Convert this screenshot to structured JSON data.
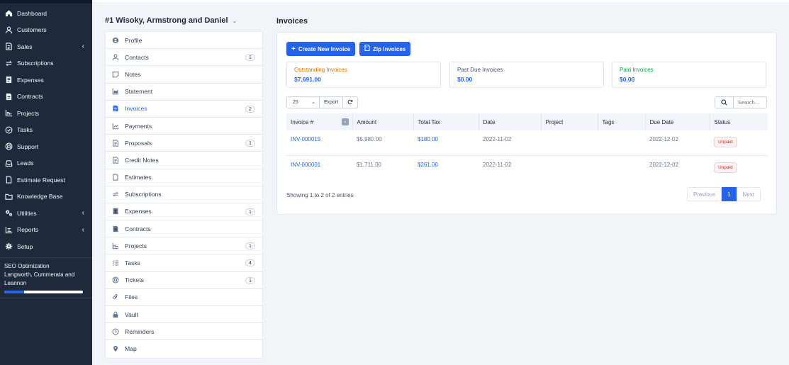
{
  "sidebar": {
    "items": [
      {
        "label": "Dashboard",
        "icon": "home-icon",
        "submenu": false
      },
      {
        "label": "Customers",
        "icon": "user-icon",
        "submenu": false
      },
      {
        "label": "Sales",
        "icon": "document-icon",
        "submenu": true
      },
      {
        "label": "Subscriptions",
        "icon": "refresh-icon",
        "submenu": false
      },
      {
        "label": "Expenses",
        "icon": "receipt-icon",
        "submenu": false
      },
      {
        "label": "Contracts",
        "icon": "contract-icon",
        "submenu": false
      },
      {
        "label": "Projects",
        "icon": "chart-icon",
        "submenu": false
      },
      {
        "label": "Tasks",
        "icon": "check-circle-icon",
        "submenu": false
      },
      {
        "label": "Support",
        "icon": "lifebuoy-icon",
        "submenu": false
      },
      {
        "label": "Leads",
        "icon": "inbox-icon",
        "submenu": false
      },
      {
        "label": "Estimate Request",
        "icon": "file-icon",
        "submenu": false
      },
      {
        "label": "Knowledge Base",
        "icon": "folder-icon",
        "submenu": false
      },
      {
        "label": "Utilities",
        "icon": "cogs-icon",
        "submenu": true
      },
      {
        "label": "Reports",
        "icon": "bar-chart-icon",
        "submenu": true
      },
      {
        "label": "Setup",
        "icon": "gear-icon",
        "submenu": false
      }
    ],
    "project": {
      "name": "SEO Optimization",
      "client": "Langworth, Cummerata and Leannon",
      "progress": 0.25
    }
  },
  "customer": {
    "title": "#1 Wisoky, Armstrong and Daniel",
    "menu": [
      {
        "label": "Profile",
        "icon": "user-circle-icon",
        "badge": ""
      },
      {
        "label": "Contacts",
        "icon": "user-icon",
        "badge": "1"
      },
      {
        "label": "Notes",
        "icon": "note-icon",
        "badge": ""
      },
      {
        "label": "Statement",
        "icon": "chart-area-icon",
        "badge": ""
      },
      {
        "label": "Invoices",
        "icon": "invoice-icon",
        "badge": "2",
        "active": true
      },
      {
        "label": "Payments",
        "icon": "line-chart-icon",
        "badge": ""
      },
      {
        "label": "Proposals",
        "icon": "document-icon",
        "badge": "1"
      },
      {
        "label": "Credit Notes",
        "icon": "document-icon",
        "badge": ""
      },
      {
        "label": "Estimates",
        "icon": "file-icon",
        "badge": ""
      },
      {
        "label": "Subscriptions",
        "icon": "refresh-icon",
        "badge": ""
      },
      {
        "label": "Expenses",
        "icon": "receipt-icon",
        "badge": "1"
      },
      {
        "label": "Contracts",
        "icon": "contract-icon",
        "badge": ""
      },
      {
        "label": "Projects",
        "icon": "chart-icon",
        "badge": "1"
      },
      {
        "label": "Tasks",
        "icon": "list-icon",
        "badge": "4"
      },
      {
        "label": "Tickets",
        "icon": "lifebuoy-icon",
        "badge": "1"
      },
      {
        "label": "Files",
        "icon": "paperclip-icon",
        "badge": ""
      },
      {
        "label": "Vault",
        "icon": "lock-icon",
        "badge": ""
      },
      {
        "label": "Reminders",
        "icon": "clock-icon",
        "badge": ""
      },
      {
        "label": "Map",
        "icon": "map-pin-icon",
        "badge": ""
      }
    ]
  },
  "main": {
    "title": "Invoices",
    "create_button": "Create New Invoice",
    "zip_button": "Zip Invoices",
    "stats": [
      {
        "label": "Outstanding Invoices",
        "value": "$7,691.00",
        "color": "#d97706"
      },
      {
        "label": "Past Due Invoices",
        "value": "$0.00",
        "color": "#475569"
      },
      {
        "label": "Paid Invoices",
        "value": "$0.00",
        "color": "#16a34a"
      }
    ],
    "page_length": "25",
    "export_label": "Export",
    "search_placeholder": "Search...",
    "columns": [
      "Invoice #",
      "Amount",
      "Total Tax",
      "Date",
      "Project",
      "Tags",
      "Due Date",
      "Status"
    ],
    "rows": [
      {
        "invoice": "INV-000015",
        "amount": "$5,980.00",
        "tax": "$180.00",
        "date": "2022-11-02",
        "project": "",
        "tags": "",
        "due": "2022-12-02",
        "status": "Unpaid"
      },
      {
        "invoice": "INV-000001",
        "amount": "$1,711.00",
        "tax": "$261.00",
        "date": "2022-11-02",
        "project": "",
        "tags": "",
        "due": "2022-12-02",
        "status": "Unpaid"
      }
    ],
    "showing": "Showing 1 to 2 of 2 entries",
    "pager": {
      "previous": "Previous",
      "current": "1",
      "next": "Next"
    }
  },
  "colors": {
    "accent": "#2563eb",
    "sidebar_bg": "#1e293b"
  }
}
